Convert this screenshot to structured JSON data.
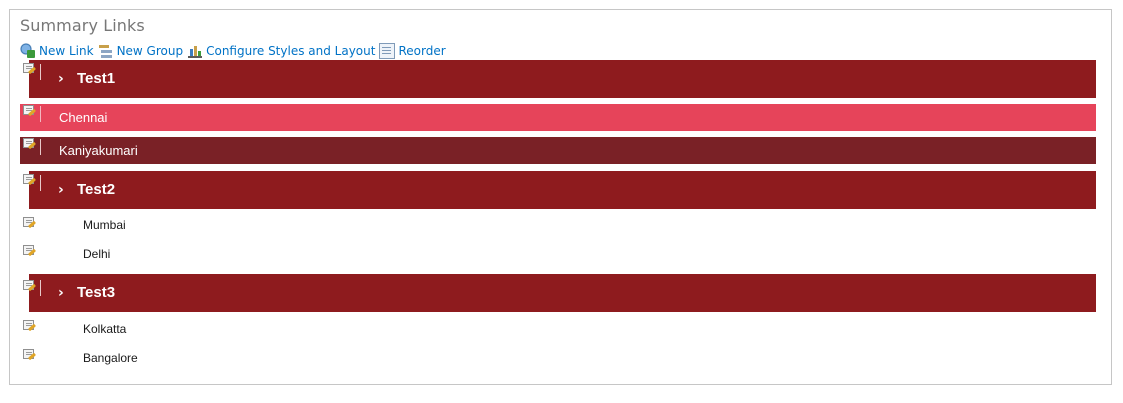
{
  "webpart": {
    "title": "Summary Links"
  },
  "toolbar": {
    "items": [
      {
        "label": "New Link",
        "icon": "new-link-icon"
      },
      {
        "label": "New Group",
        "icon": "new-group-icon"
      },
      {
        "label": "Configure Styles and Layout",
        "icon": "configure-styles-icon"
      },
      {
        "label": "Reorder",
        "icon": "reorder-icon"
      }
    ]
  },
  "groups": [
    {
      "label": "Test1",
      "expand_icon": "chevron-right-icon",
      "links": [
        {
          "label": "Chennai",
          "style": "highlight"
        },
        {
          "label": "Kaniyakumari",
          "style": "dark"
        }
      ]
    },
    {
      "label": "Test2",
      "expand_icon": "chevron-right-icon",
      "links": [
        {
          "label": "Mumbai",
          "style": "plain"
        },
        {
          "label": "Delhi",
          "style": "plain"
        }
      ]
    },
    {
      "label": "Test3",
      "expand_icon": "chevron-right-icon",
      "links": [
        {
          "label": "Kolkatta",
          "style": "plain"
        },
        {
          "label": "Bangalore",
          "style": "plain"
        }
      ]
    }
  ],
  "colors": {
    "group_header": "#8e1b1e",
    "highlight_link": "#e6445a",
    "dark_link": "#7a2126",
    "toolbar_link": "#0072c6",
    "title": "#777777"
  }
}
